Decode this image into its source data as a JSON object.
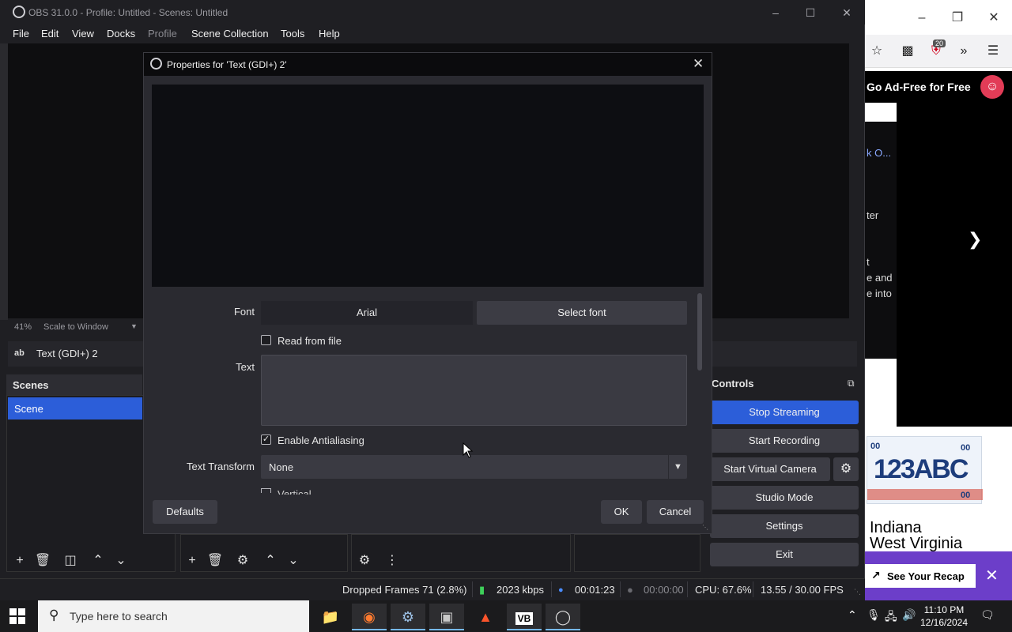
{
  "browser": {
    "notification_count": "20",
    "adfree_label": "Go Ad-Free for Free",
    "side_texts": [
      "k O...",
      "ter",
      "t",
      "e and",
      "e into"
    ],
    "plate_text": "123ABC",
    "plate_small": "00",
    "states": [
      "Indiana",
      "West Virginia"
    ],
    "recap_label": "See Your Recap"
  },
  "obs": {
    "window_title": "OBS 31.0.0 - Profile: Untitled - Scenes: Untitled",
    "menu": [
      "File",
      "Edit",
      "View",
      "Docks",
      "Profile",
      "Scene Collection",
      "Tools",
      "Help"
    ],
    "zoom_percent": "41%",
    "zoom_mode": "Scale to Window",
    "source_icon_text": "ab",
    "source_name": "Text (GDI+) 2",
    "scenes_header": "Scenes",
    "scenes": [
      "Scene"
    ],
    "controls_header": "Controls",
    "controls": [
      "Stop Streaming",
      "Start Recording",
      "Start Virtual Camera",
      "Studio Mode",
      "Settings",
      "Exit"
    ],
    "status": {
      "dropped_frames": "Dropped Frames 71 (2.8%)",
      "bitrate": "2023 kbps",
      "stream_time": "00:01:23",
      "record_time": "00:00:00",
      "cpu": "CPU: 67.6%",
      "fps": "13.55 / 30.00 FPS"
    }
  },
  "dialog": {
    "title": "Properties for 'Text (GDI+) 2'",
    "font_label": "Font",
    "font_value": "Arial",
    "select_font_label": "Select font",
    "read_from_file_label": "Read from file",
    "read_from_file_checked": false,
    "text_label": "Text",
    "text_value": "",
    "antialias_label": "Enable Antialiasing",
    "antialias_checked": true,
    "transform_label": "Text Transform",
    "transform_value": "None",
    "vertical_label": "Vertical",
    "defaults_label": "Defaults",
    "ok_label": "OK",
    "cancel_label": "Cancel"
  },
  "taskbar": {
    "search_placeholder": "Type here to search",
    "vb_label": "VB",
    "time": "11:10 PM",
    "date": "12/16/2024"
  },
  "colors": {
    "accent": "#2c5ed9",
    "window_bg": "#1f1f23",
    "button_bg": "#3c3c44"
  }
}
